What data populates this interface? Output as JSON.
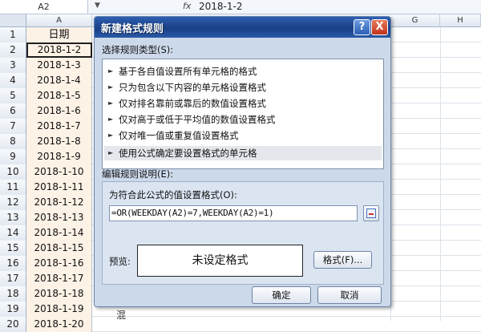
{
  "formula_bar": {
    "name_box": "A2",
    "fx": "fx",
    "formula": "2018-1-2"
  },
  "columns": {
    "a": "A",
    "g": "G",
    "h": "H"
  },
  "sheet": {
    "header_row_num": "1",
    "header_value": "日期",
    "rows": [
      {
        "num": "2",
        "value": "2018-1-2"
      },
      {
        "num": "3",
        "value": "2018-1-3"
      },
      {
        "num": "4",
        "value": "2018-1-4"
      },
      {
        "num": "5",
        "value": "2018-1-5"
      },
      {
        "num": "6",
        "value": "2018-1-6"
      },
      {
        "num": "7",
        "value": "2018-1-7"
      },
      {
        "num": "8",
        "value": "2018-1-8"
      },
      {
        "num": "9",
        "value": "2018-1-9"
      },
      {
        "num": "10",
        "value": "2018-1-10"
      },
      {
        "num": "11",
        "value": "2018-1-11"
      },
      {
        "num": "12",
        "value": "2018-1-12"
      },
      {
        "num": "13",
        "value": "2018-1-13"
      },
      {
        "num": "14",
        "value": "2018-1-14"
      },
      {
        "num": "15",
        "value": "2018-1-15"
      },
      {
        "num": "16",
        "value": "2018-1-16"
      },
      {
        "num": "17",
        "value": "2018-1-17"
      },
      {
        "num": "18",
        "value": "2018-1-18"
      },
      {
        "num": "19",
        "value": "2018-1-19"
      },
      {
        "num": "20",
        "value": "2018-1-20"
      }
    ],
    "stray_text": "混"
  },
  "dialog": {
    "title": "新建格式规则",
    "help_label": "?",
    "close_label": "X",
    "rule_type_label": "选择规则类型(S):",
    "rule_types": [
      "基于各自值设置所有单元格的格式",
      "只为包含以下内容的单元格设置格式",
      "仅对排名靠前或靠后的数值设置格式",
      "仅对高于或低于平均值的数值设置格式",
      "仅对唯一值或重复值设置格式",
      "使用公式确定要设置格式的单元格"
    ],
    "selected_rule_index": 5,
    "edit_label": "编辑规则说明(E):",
    "formula_label": "为符合此公式的值设置格式(O):",
    "formula_value": "=OR(WEEKDAY(A2)=7,WEEKDAY(A2)=1)",
    "preview_label": "预览:",
    "preview_text": "未设定格式",
    "format_button": "格式(F)...",
    "ok_button": "确定",
    "cancel_button": "取消"
  },
  "colors": {
    "title_bar": "#1a3f85",
    "close_button": "#c1321a",
    "date_cell_fill": "#fdf2e6",
    "dialog_bg": "#ccd9ea"
  }
}
